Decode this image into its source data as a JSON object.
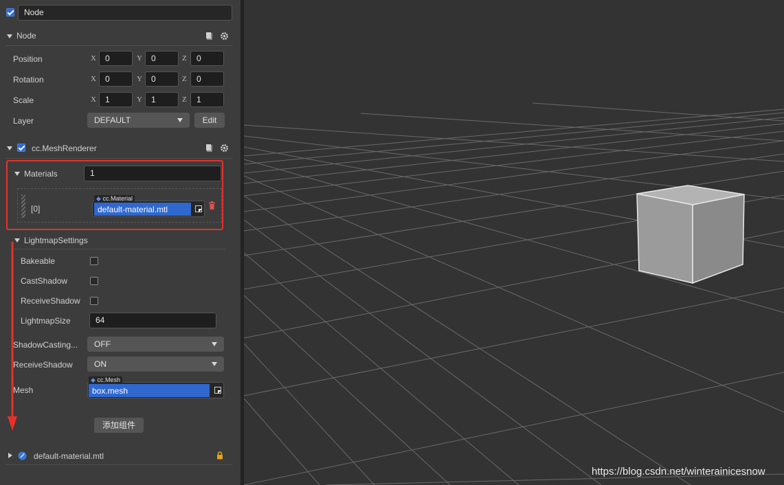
{
  "node_name": "Node",
  "node_section": {
    "title": "Node",
    "position": {
      "label": "Position",
      "x": "0",
      "y": "0",
      "z": "0"
    },
    "rotation": {
      "label": "Rotation",
      "x": "0",
      "y": "0",
      "z": "0"
    },
    "scale": {
      "label": "Scale",
      "x": "1",
      "y": "1",
      "z": "1"
    },
    "layer": {
      "label": "Layer",
      "value": "DEFAULT",
      "edit": "Edit"
    },
    "axes": {
      "x": "X",
      "y": "Y",
      "z": "Z"
    }
  },
  "mesh_renderer": {
    "title": "cc.MeshRenderer",
    "materials_label": "Materials",
    "materials_count": "1",
    "material_index": "[0]",
    "material_type": "cc.Material",
    "material_value": "default-material.mtl",
    "lightmap_title": "LightmapSettings",
    "bakeable": "Bakeable",
    "cast_shadow": "CastShadow",
    "receive_shadow": "ReceiveShadow",
    "lightmap_size_label": "LightmapSize",
    "lightmap_size": "64",
    "shadow_casting_label": "ShadowCasting...",
    "shadow_casting_value": "OFF",
    "receive_shadow_label": "ReceiveShadow",
    "receive_shadow_value": "ON",
    "mesh_label": "Mesh",
    "mesh_type": "cc.Mesh",
    "mesh_value": "box.mesh"
  },
  "add_component": "添加组件",
  "asset_footer": {
    "name": "default-material.mtl"
  },
  "watermark": "https://blog.csdn.net/winterainicesnow",
  "colors": {
    "annotation": "#e8302a",
    "selection": "#2f68cf",
    "viewport_bg": "#333333"
  },
  "icons": [
    "checkbox-icon",
    "book-icon",
    "gear-icon",
    "trash-icon",
    "picker-icon",
    "material-icon",
    "lock-icon"
  ]
}
